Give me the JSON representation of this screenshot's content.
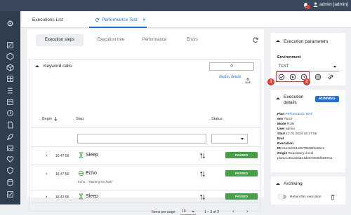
{
  "topbar": {
    "user": "admin [admin]",
    "notifications": "bell-icon"
  },
  "tabs": {
    "executions_list": "Executions List",
    "performance_test": "Performance Test",
    "close": "✕"
  },
  "subtabs": [
    "Execution steps",
    "Execution tree",
    "Performance",
    "Errors"
  ],
  "keyword_calls": {
    "title": "Keyword calls",
    "counter": "0",
    "display_link": "display details",
    "columns": {
      "begin": "Begin",
      "step": "Step",
      "status": "Status"
    },
    "rows": [
      {
        "time": "16:47:56",
        "label": "Sleep",
        "icon": "hourglass-icon",
        "status": "PASSED",
        "sub": ""
      },
      {
        "time": "16:47:56",
        "label": "Echo",
        "icon": "echo-icon",
        "status": "PASSED",
        "sub": "Echo : \"Starting K6 Task\""
      },
      {
        "time": "16:47:55",
        "label": "Sleep",
        "icon": "hourglass-icon",
        "status": "PASSED",
        "sub": ""
      }
    ],
    "pager": {
      "items_per_page_label": "Items per page:",
      "items_per_page": "10",
      "range": "1 – 3 of 3"
    }
  },
  "execution_parameters": {
    "title": "Execution parameters",
    "environment_label": "Environment",
    "environment_value": "TEST",
    "markers": [
      "1",
      "2"
    ]
  },
  "execution_details": {
    "title_line1": "Execution",
    "title_line2": "details",
    "status": "RUNNING",
    "fields": [
      {
        "key": "Plan",
        "value": "Performance Test",
        "link": true
      },
      {
        "key": "env",
        "value": "TEST",
        "link": false
      },
      {
        "key": "Mode",
        "value": "RUN",
        "link": false
      },
      {
        "key": "User",
        "value": "admin",
        "link": false
      },
      {
        "key": "Start",
        "value": "12.01.2024 16:47:55",
        "link": false
      },
      {
        "key": "End",
        "value": "",
        "link": false
      },
      {
        "key": "Execution",
        "value": "",
        "link": false
      },
      {
        "key": "ID",
        "value": "65a15f2b1d257850bfba95ce",
        "link": false
      },
      {
        "key": "Origin",
        "value": "Repository=local",
        "link": false
      },
      {
        "key": "",
        "value": "planid=65a15b621d257850bfb997ea",
        "link": false
      }
    ]
  },
  "archiving": {
    "title": "Archiving",
    "toggle_label": "Retain this execution"
  },
  "colors": {
    "accent": "#1e6fd9",
    "sidebar": "#2f3e4f",
    "topbar": "#3a4a5c",
    "passed": "#43a047",
    "marker": "#e53935"
  }
}
